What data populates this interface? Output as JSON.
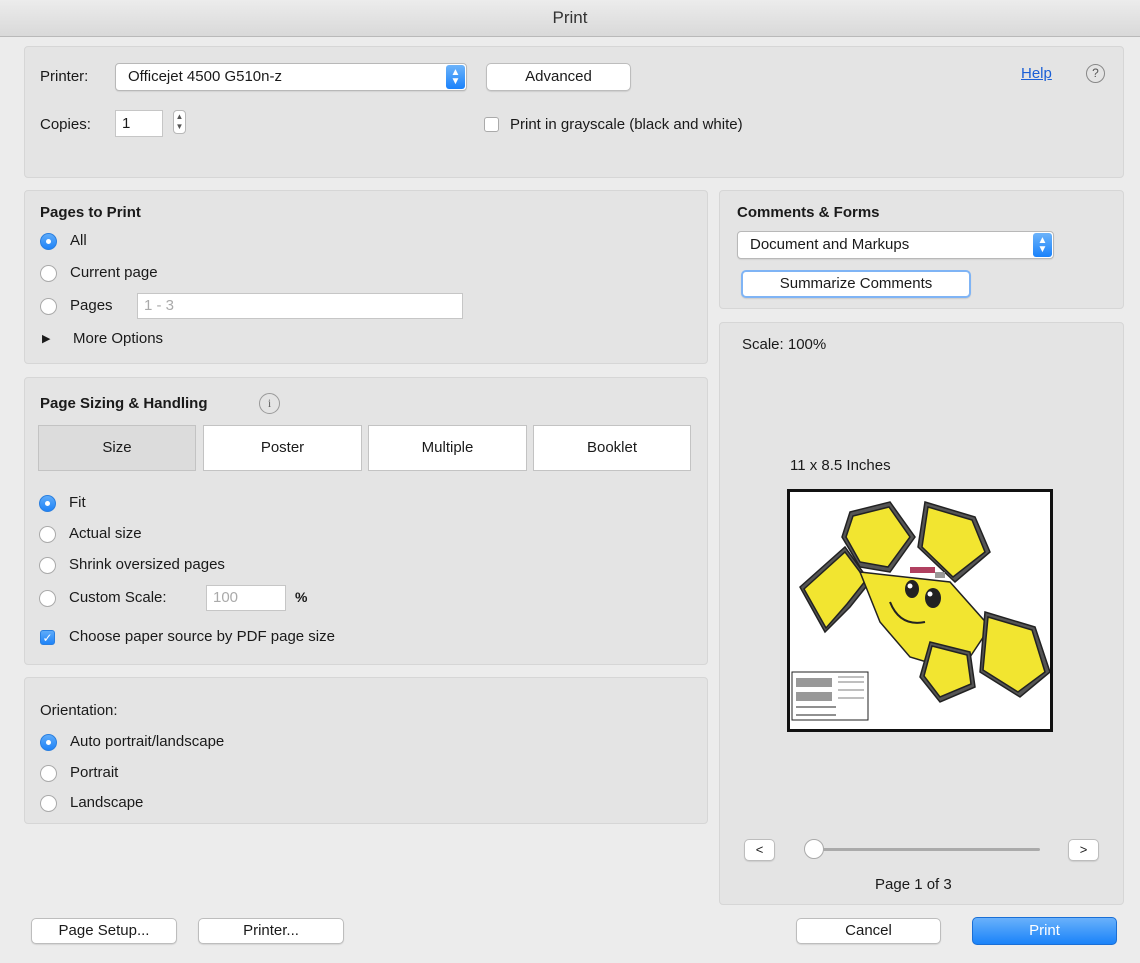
{
  "window": {
    "title": "Print"
  },
  "printer": {
    "label": "Printer:",
    "selected": "Officejet 4500 G510n-z",
    "advanced_label": "Advanced",
    "help_label": "Help",
    "copies_label": "Copies:",
    "copies_value": "1",
    "grayscale_label": "Print in grayscale (black and white)",
    "grayscale_checked": false
  },
  "pages_to_print": {
    "title": "Pages to Print",
    "options": [
      "All",
      "Current page",
      "Pages"
    ],
    "selected": "All",
    "pages_placeholder": "1 - 3",
    "more_options_label": "More Options"
  },
  "page_sizing": {
    "title": "Page Sizing & Handling",
    "tabs": [
      "Size",
      "Poster",
      "Multiple",
      "Booklet"
    ],
    "selected_tab": "Size",
    "options": [
      "Fit",
      "Actual size",
      "Shrink oversized pages",
      "Custom Scale:"
    ],
    "selected": "Fit",
    "custom_scale_value": "100",
    "percent_label": "%",
    "paper_source_label": "Choose paper source by PDF page size",
    "paper_source_checked": true
  },
  "orientation": {
    "title": "Orientation:",
    "options": [
      "Auto portrait/landscape",
      "Portrait",
      "Landscape"
    ],
    "selected": "Auto portrait/landscape"
  },
  "comments_forms": {
    "title": "Comments & Forms",
    "selected": "Document and Markups",
    "summarize_label": "Summarize Comments"
  },
  "preview": {
    "scale_label": "Scale: 100%",
    "size_label": "11 x 8.5 Inches",
    "page_label": "Page 1 of 3",
    "prev_label": "<",
    "next_label": ">",
    "slider_position": 0
  },
  "footer": {
    "page_setup_label": "Page Setup...",
    "printer_label": "Printer...",
    "cancel_label": "Cancel",
    "print_label": "Print"
  },
  "colors": {
    "accent": "#1a83f9",
    "face_yellow": "#f2e530"
  }
}
